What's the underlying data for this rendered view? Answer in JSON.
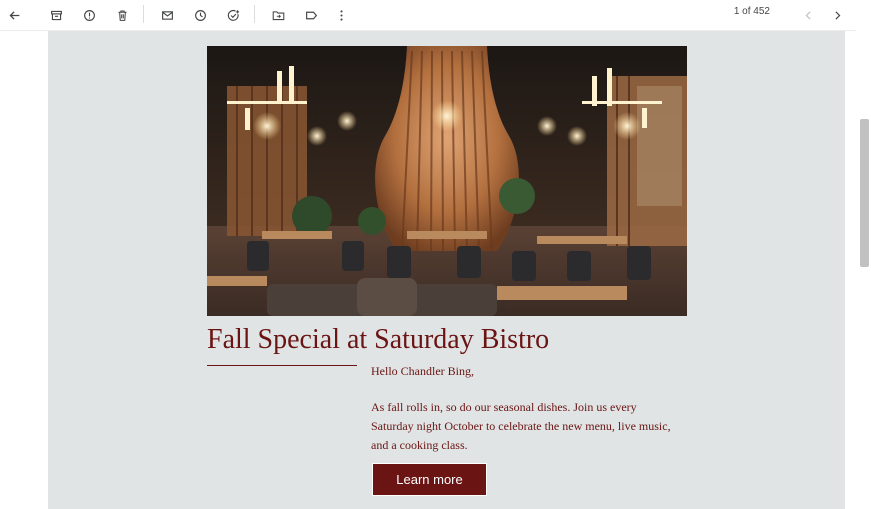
{
  "toolbar": {
    "buttons": [
      {
        "name": "back-arrow-icon"
      },
      {
        "name": "archive-icon"
      },
      {
        "name": "report-spam-icon"
      },
      {
        "name": "delete-icon"
      },
      {
        "name": "mark-unread-icon"
      },
      {
        "name": "snooze-icon"
      },
      {
        "name": "add-task-icon"
      },
      {
        "name": "move-to-icon"
      },
      {
        "name": "label-icon"
      },
      {
        "name": "more-options-icon"
      }
    ],
    "pager_text": "1 of 452",
    "colors": {
      "icon": "#444746",
      "icon_disabled": "#bdc1c6"
    }
  },
  "email": {
    "title": "Fall Special at Saturday Bistro",
    "greeting": "Hello Chandler Bing,",
    "body": "As fall rolls in, so do our seasonal dishes. Join us every Saturday night October to celebrate the new menu, live music, and a cooking class.",
    "cta_label": "Learn more",
    "colors": {
      "accent": "#6b1414",
      "background": "#e0e4e4"
    }
  }
}
